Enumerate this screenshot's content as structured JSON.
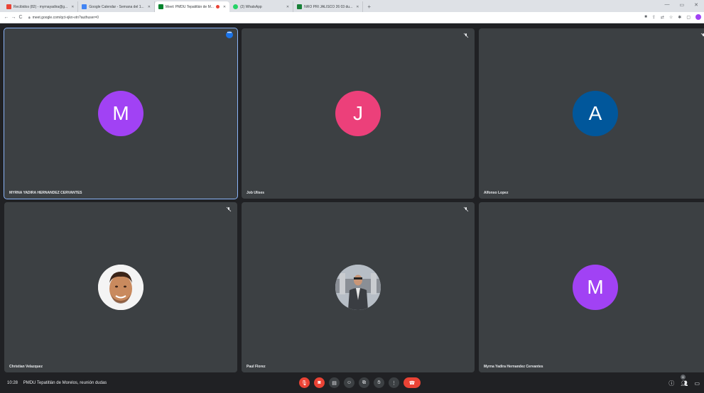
{
  "browser": {
    "tabs": [
      {
        "label": "Recibidos (82) - myrnayadira@g...",
        "favicon_color": "#ea4335",
        "active": false
      },
      {
        "label": "Google Calendar - Semana del 1...",
        "favicon_color": "#4285f4",
        "active": false
      },
      {
        "label": "Meet: PMDU Tepatitlán de M...",
        "favicon_color": "#00832d",
        "active": true
      },
      {
        "label": "(2) WhatsApp",
        "favicon_color": "#25d366",
        "active": false
      },
      {
        "label": "NRO PRI JALISCO 26 03 du...",
        "favicon_color": "#188038",
        "active": false
      }
    ],
    "url": "meet.google.com/qct-xjkn-vtn?authuser=0",
    "newtab_label": "+",
    "window_controls": [
      "—",
      "▭",
      "✕"
    ],
    "nav": {
      "back": "←",
      "forward": "→",
      "reload": "C"
    }
  },
  "meet": {
    "participants": [
      {
        "name": "MYRNA YADIRA HERNANDEZ CERVANTES",
        "initial": "M",
        "avatar_color": "#a142f4",
        "type": "initial",
        "muted": false,
        "speaking": true
      },
      {
        "name": "Job Ulises",
        "initial": "J",
        "avatar_color": "#ec407a",
        "type": "initial",
        "muted": true,
        "speaking": false
      },
      {
        "name": "Alfonso Lopez",
        "initial": "A",
        "avatar_color": "#01579b",
        "type": "initial",
        "muted": true,
        "speaking": false
      },
      {
        "name": "Christian Velazquez",
        "initial": "",
        "avatar_color": "#c27a4a",
        "type": "photo",
        "muted": true,
        "speaking": false
      },
      {
        "name": "Paul Florez",
        "initial": "",
        "avatar_color": "#8a8f96",
        "type": "photo",
        "muted": true,
        "speaking": false
      },
      {
        "name": "Myrna Yadira Hernandez Cervantes",
        "initial": "M",
        "avatar_color": "#a142f4",
        "type": "initial",
        "muted": false,
        "speaking": false
      }
    ],
    "bottom": {
      "time": "10:28",
      "meeting_title": "PMDU Tepatitlán de Morelos, reunión dudas",
      "people_count": "6"
    }
  }
}
